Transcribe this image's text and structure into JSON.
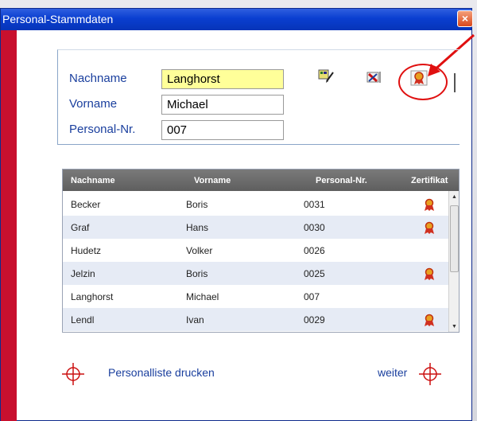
{
  "window": {
    "title": "Personal-Stammdaten",
    "close_glyph": "×"
  },
  "form": {
    "nachname_label": "Nachname",
    "nachname_value": "Langhorst",
    "vorname_label": "Vorname",
    "vorname_value": "Michael",
    "personalnr_label": "Personal-Nr.",
    "personalnr_value": "007"
  },
  "toolbar": {
    "icons": [
      "edit-document-icon",
      "delete-icon",
      "certificate-icon"
    ]
  },
  "table": {
    "columns": [
      "Nachname",
      "Vorname",
      "Personal-Nr.",
      "Zertifikat"
    ],
    "rows": [
      {
        "nachname": "Becker",
        "vorname": "Boris",
        "nr": "0031",
        "cert": true
      },
      {
        "nachname": "Graf",
        "vorname": "Hans",
        "nr": "0030",
        "cert": true
      },
      {
        "nachname": "Hudetz",
        "vorname": "Volker",
        "nr": "0026",
        "cert": false
      },
      {
        "nachname": "Jelzin",
        "vorname": "Boris",
        "nr": "0025",
        "cert": true
      },
      {
        "nachname": "Langhorst",
        "vorname": "Michael",
        "nr": "007",
        "cert": false
      },
      {
        "nachname": "Lendl",
        "vorname": "Ivan",
        "nr": "0029",
        "cert": true
      }
    ]
  },
  "footer": {
    "print_label": "Personalliste drucken",
    "next_label": "weiter"
  },
  "colors": {
    "title_bar": "#0a3ed0",
    "accent_red": "#c8102e",
    "label_blue": "#1a3f9e",
    "highlight_field": "#ffff99"
  }
}
